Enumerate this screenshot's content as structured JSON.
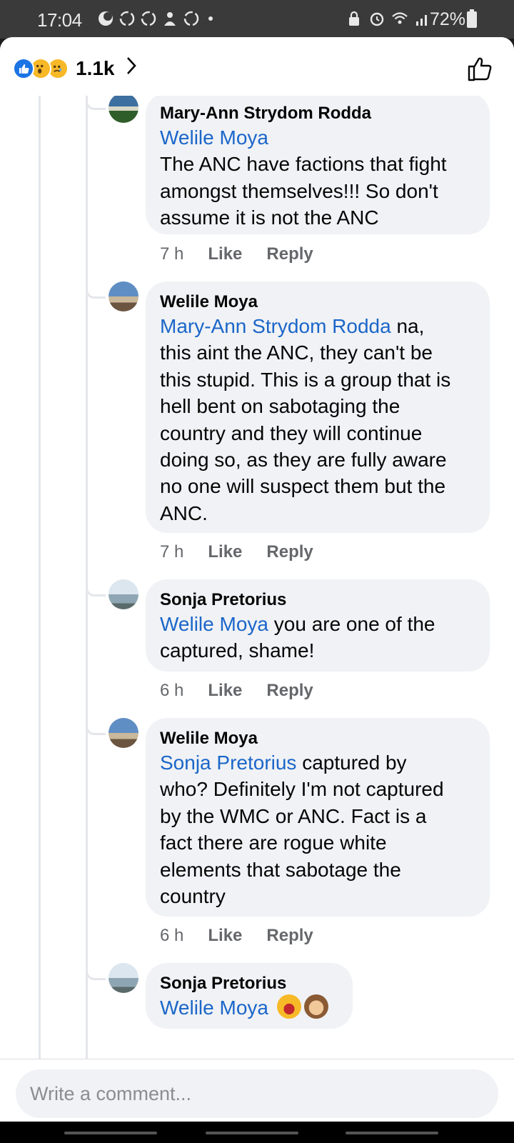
{
  "status_bar": {
    "time": "17:04",
    "battery": "72%",
    "left_icons": [
      "moon-icon",
      "recycle-icon",
      "recycle-icon",
      "person-icon",
      "recycle-icon"
    ],
    "right_icons": [
      "lock-icon",
      "alarm-icon",
      "wifi-icon",
      "signal-icon"
    ]
  },
  "header": {
    "reaction_count": "1.1k",
    "reactions": [
      "like",
      "wow",
      "sad"
    ]
  },
  "comments": [
    {
      "author": "Mary-Ann Strydom Rodda",
      "mention": "Welile Moya",
      "text_lines": [
        "The ANC have factions that fight",
        "amongst themselves!!!  So don't",
        "assume it is not the ANC"
      ],
      "time": "7 h",
      "like_label": "Like",
      "reply_label": "Reply"
    },
    {
      "author": "Welile Moya",
      "mention": "Mary-Ann Strydom Rodda",
      "first_line_rest": " na,",
      "text_lines": [
        "this aint the ANC, they can't be",
        "this stupid. This is a group that is",
        "hell bent on sabotaging the",
        "country and they will continue",
        "doing so, as they are fully aware",
        "no one will suspect them but the",
        "ANC."
      ],
      "time": "7 h",
      "like_label": "Like",
      "reply_label": "Reply"
    },
    {
      "author": "Sonja Pretorius",
      "mention": "Welile Moya",
      "first_line_rest": " you are one of the",
      "text_lines": [
        "captured, shame!"
      ],
      "time": "6 h",
      "like_label": "Like",
      "reply_label": "Reply"
    },
    {
      "author": "Welile Moya",
      "mention": "Sonja Pretorius",
      "first_line_rest": "  captured by",
      "text_lines": [
        "who? Definitely I'm not captured",
        "by the WMC or ANC. Fact is a",
        "fact there are rogue white",
        "elements that sabotage the",
        "country"
      ],
      "time": "6 h",
      "like_label": "Like",
      "reply_label": "Reply"
    },
    {
      "author": "Sonja Pretorius",
      "mention": "Welile Moya",
      "emojis": [
        "rolling-on-floor-laughing",
        "see-no-evil-monkey"
      ]
    }
  ],
  "composer": {
    "placeholder": "Write a comment..."
  }
}
